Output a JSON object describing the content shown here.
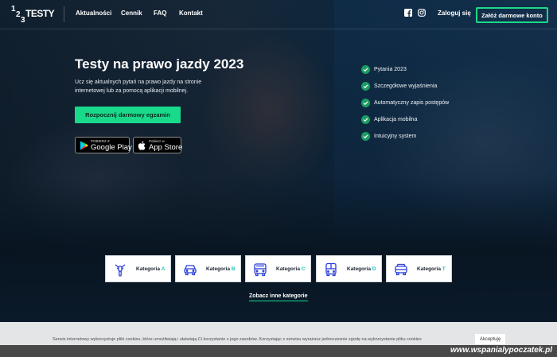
{
  "nav": {
    "logo_digits": [
      "1",
      "2",
      "3"
    ],
    "logo_word": "TESTY",
    "links": [
      "Aktualności",
      "Cennik",
      "FAQ",
      "Kontakt"
    ],
    "social": [
      "facebook-icon",
      "instagram-icon"
    ],
    "login_label": "Zaloguj się",
    "register_label": "Załóż darmowe konto"
  },
  "hero": {
    "title_plain": "Testy",
    "title_bold": "na prawo jazdy 2023",
    "description": "Ucz się aktualnych pytań na prawo jazdy na stronie internetowej lub za pomocą aplikacji mobilnej.",
    "cta_label": "Rozpocznij darmowy egzamin",
    "google_play": {
      "small": "POBIERZ Z",
      "big": "Google Play"
    },
    "app_store": {
      "small": "Pobierz w",
      "big": "App Store"
    }
  },
  "features": [
    "Pytania 2023",
    "Szczegółowe wyjaśnienia",
    "Automatyczny zapis postępów",
    "Aplikacja mobilna",
    "Intuicyjny system"
  ],
  "categories": [
    {
      "prefix": "Kategoria",
      "letter": "A",
      "icon": "motorcycle-icon"
    },
    {
      "prefix": "Kategoria",
      "letter": "B",
      "icon": "car-icon"
    },
    {
      "prefix": "Kategoria",
      "letter": "C",
      "icon": "truck-icon"
    },
    {
      "prefix": "Kategoria",
      "letter": "D",
      "icon": "bus-icon"
    },
    {
      "prefix": "Kategoria",
      "letter": "T",
      "icon": "tractor-icon"
    }
  ],
  "more_categories_label": "Zobacz inne kategorie",
  "cookie": {
    "text": "Serwis internetowy wykorzystuje pliki cookies, które umożliwiają i ułatwiają Ci korzystanie z jego zasobów. Korzystając z serwisu wyrażasz jednoczesnie zgodę na wykorzystanie pliku cookies",
    "accept_label": "Akceptuję"
  },
  "watermark": "www.wspanialypoczatek.pl",
  "colors": {
    "accent": "#19d98b",
    "category_letter": "#19c8c0",
    "icon_blue": "#2b3fd6"
  }
}
